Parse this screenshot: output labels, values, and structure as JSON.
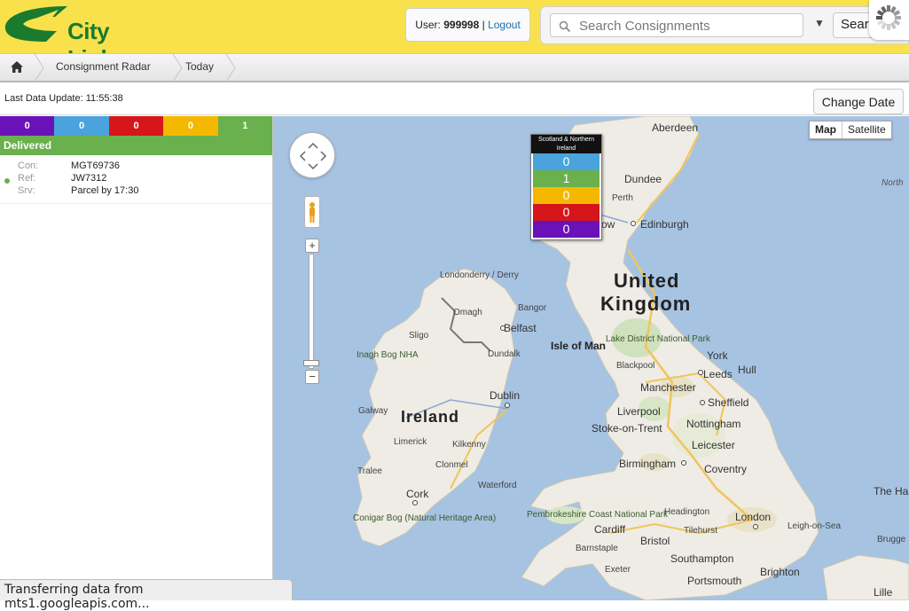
{
  "brand": {
    "name": "City Link",
    "color": "#1a7a2e",
    "header_bg": "#f8e14b"
  },
  "user": {
    "label": "User:",
    "id": "999998",
    "separator": "|",
    "logout": "Logout"
  },
  "search": {
    "placeholder": "Search Consignments",
    "button": "Search",
    "icon": "search-icon"
  },
  "breadcrumb": {
    "home_icon": "home-icon",
    "items": [
      "Consignment Radar",
      "Today"
    ]
  },
  "update": {
    "text": "Last Data Update: 11:55:38",
    "change_date": "Change Date"
  },
  "counts": [
    {
      "value": "0",
      "color": "#6b11b8"
    },
    {
      "value": "0",
      "color": "#4aa3dc"
    },
    {
      "value": "0",
      "color": "#d6161a"
    },
    {
      "value": "0",
      "color": "#f5b800"
    },
    {
      "value": "1",
      "color": "#6ab04c"
    }
  ],
  "status_header": "Delivered",
  "consignments": [
    {
      "con_label": "Con:",
      "con": "MGT69736",
      "ref_label": "Ref:",
      "ref": "JW7312",
      "srv_label": "Srv:",
      "srv": "Parcel by 17:30"
    }
  ],
  "map": {
    "type_buttons": {
      "map": "Map",
      "satellite": "Satellite"
    },
    "region_box": {
      "title": "Scotland & Northern Ireland",
      "counts": [
        {
          "value": "0",
          "color": "#4aa3dc"
        },
        {
          "value": "1",
          "color": "#6ab04c"
        },
        {
          "value": "0",
          "color": "#f5b800"
        },
        {
          "value": "0",
          "color": "#d6161a"
        },
        {
          "value": "0",
          "color": "#6b11b8"
        }
      ]
    },
    "labels": {
      "uk_line1": "United",
      "uk_line2": "Kingdom",
      "ireland": "Ireland",
      "isle_of_man": "Isle of Man",
      "aberdeen": "Aberdeen",
      "dundee": "Dundee",
      "perth": "Perth",
      "edinburgh": "Edinburgh",
      "glasgow_partial": "ow",
      "north_sea": "North",
      "londonderry": "Londonderry / Derry",
      "omagh": "Omagh",
      "bangor": "Bangor",
      "belfast": "Belfast",
      "sligo": "Sligo",
      "dundalk": "Dundalk",
      "inagh": "Inagh Bog NHA",
      "lake_district": "Lake District National Park",
      "blackpool": "Blackpool",
      "york": "York",
      "hull": "Hull",
      "leeds": "Leeds",
      "manchester": "Manchester",
      "sheffield": "Sheffield",
      "liverpool": "Liverpool",
      "dublin": "Dublin",
      "galway": "Galway",
      "stoke": "Stoke-on-Trent",
      "nottingham": "Nottingham",
      "limerick": "Limerick",
      "kilkenny": "Kilkenny",
      "leicester": "Leicester",
      "birmingham": "Birmingham",
      "coventry": "Coventry",
      "tralee": "Tralee",
      "clonmel": "Clonmel",
      "waterford": "Waterford",
      "cork": "Cork",
      "conigar": "Conigar Bog (Natural Heritage Area)",
      "pembrokeshire": "Pembrokeshire Coast National Park",
      "headington": "Headington",
      "hague_partial": "The Ha",
      "cardiff": "Cardiff",
      "bristol": "Bristol",
      "tilehurst": "Tilehurst",
      "london": "London",
      "leigh": "Leigh-on-Sea",
      "barnstaple": "Barnstaple",
      "southampton": "Southampton",
      "brighton": "Brighton",
      "brugge": "Brugge",
      "exeter": "Exeter",
      "portsmouth": "Portsmouth",
      "lille": "Lille"
    }
  },
  "statusbar": "Transferring data from mts1.googleapis.com..."
}
